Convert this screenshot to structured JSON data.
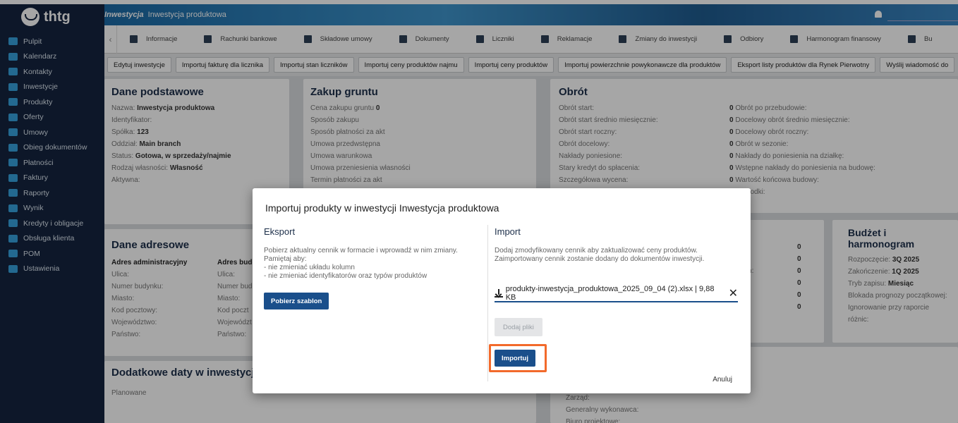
{
  "logo": {
    "text": "thtg"
  },
  "sidebar": {
    "items": [
      {
        "label": "Pulpit"
      },
      {
        "label": "Kalendarz"
      },
      {
        "label": "Kontakty"
      },
      {
        "label": "Inwestycje"
      },
      {
        "label": "Produkty"
      },
      {
        "label": "Oferty"
      },
      {
        "label": "Umowy"
      },
      {
        "label": "Obieg dokumentów"
      },
      {
        "label": "Płatności"
      },
      {
        "label": "Faktury"
      },
      {
        "label": "Raporty"
      },
      {
        "label": "Wynik"
      },
      {
        "label": "Kredyty i obligacje"
      },
      {
        "label": "Obsługa klienta"
      },
      {
        "label": "POM"
      },
      {
        "label": "Ustawienia"
      }
    ]
  },
  "header": {
    "crumb_main": "Inwestycja",
    "crumb_sub": "Inwestycja produktowa"
  },
  "tabs": [
    {
      "label": "Informacje"
    },
    {
      "label": "Rachunki bankowe"
    },
    {
      "label": "Składowe umowy"
    },
    {
      "label": "Dokumenty"
    },
    {
      "label": "Liczniki"
    },
    {
      "label": "Reklamacje"
    },
    {
      "label": "Zmiany do inwestycji"
    },
    {
      "label": "Odbiory"
    },
    {
      "label": "Harmonogram finansowy"
    },
    {
      "label": "Bu"
    }
  ],
  "actions": [
    {
      "label": "Edytuj inwestycje"
    },
    {
      "label": "Importuj fakturę dla licznika"
    },
    {
      "label": "Importuj stan liczników"
    },
    {
      "label": "Importuj ceny produktów najmu"
    },
    {
      "label": "Importuj ceny produktów"
    },
    {
      "label": "Importuj powierzchnie powykonawcze dla produktów"
    },
    {
      "label": "Eksport listy produktów dla Rynek Pierwotny"
    },
    {
      "label": "Wyślij wiadomość do"
    }
  ],
  "basic": {
    "title": "Dane podstawowe",
    "rows": [
      {
        "label": "Nazwa:",
        "value": "Inwestycja produktowa"
      },
      {
        "label": "Identyfikator:",
        "value": ""
      },
      {
        "label": "Spółka:",
        "value": "123"
      },
      {
        "label": "Oddział:",
        "value": "Main branch"
      },
      {
        "label": "Status:",
        "value": "Gotowa, w sprzedaży/najmie"
      },
      {
        "label": "Rodzaj własności:",
        "value": "Własność"
      },
      {
        "label": "Aktywna:",
        "value": ""
      }
    ]
  },
  "land": {
    "title": "Zakup gruntu",
    "rows": [
      {
        "label": "Cena zakupu gruntu",
        "value": "0"
      },
      {
        "label": "Sposób zakupu",
        "value": ""
      },
      {
        "label": "Sposób płatności za akt",
        "value": ""
      },
      {
        "label": "Umowa przedwstępna",
        "value": ""
      },
      {
        "label": "Umowa warunkowa",
        "value": ""
      },
      {
        "label": "Umowa przeniesienia własności",
        "value": ""
      },
      {
        "label": "Termin płatności za akt",
        "value": ""
      }
    ]
  },
  "turnover": {
    "title": "Obrót",
    "left": [
      {
        "label": "Obrót start:",
        "value": "0"
      },
      {
        "label": "Obrót start średnio miesięcznie:",
        "value": "0"
      },
      {
        "label": "Obrót start roczny:",
        "value": "0"
      },
      {
        "label": "Obrót docelowy:",
        "value": "0"
      },
      {
        "label": "Nakłady poniesione:",
        "value": "0"
      },
      {
        "label": "Stary kredyt do spłacenia:",
        "value": "0"
      },
      {
        "label": "Szczegółowa wycena:",
        "value": "0"
      }
    ],
    "right": [
      {
        "label": "Obrót po przebudowie:"
      },
      {
        "label": "Docelowy obrót średnio miesięcznie:"
      },
      {
        "label": "Docelowy obrót roczny:"
      },
      {
        "label": "Obrót w sezonie:"
      },
      {
        "label": "Nakłady do poniesienia na działkę:"
      },
      {
        "label": "Wstępne nakłady do poniesienia na budowę:"
      },
      {
        "label": "Wartość końcowa budowy:"
      },
      {
        "label": "jące środki:"
      }
    ]
  },
  "address": {
    "title": "Dane adresowe",
    "col1_head": "Adres administracyjny",
    "col2_head": "Adres budo",
    "rows": [
      {
        "label": "Ulica:"
      },
      {
        "label": "Numer budynku:"
      },
      {
        "label": "Miasto:"
      },
      {
        "label": "Kod pocztowy:"
      },
      {
        "label": "Województwo:"
      },
      {
        "label": "Państwo:"
      }
    ],
    "rows2": [
      {
        "label": "Ulica:"
      },
      {
        "label": "Numer bud"
      },
      {
        "label": "Miasto:"
      },
      {
        "label": "Kod poczt"
      },
      {
        "label": "Województ"
      },
      {
        "label": "Państwo:"
      }
    ]
  },
  "mid_partial": {
    "labels": [
      {
        "label": "munikacyjnych:"
      },
      {
        "label": "emców:"
      }
    ],
    "values": [
      "0",
      "0",
      "0",
      "0",
      "0",
      "0"
    ]
  },
  "budget": {
    "title": "Budżet i harmonogram",
    "rows": [
      {
        "label": "Rozpoczęcie:",
        "value": "3Q 2025"
      },
      {
        "label": "Zakończenie:",
        "value": "1Q 2025"
      },
      {
        "label": "Tryb zapisu:",
        "value": "Miesiąc"
      },
      {
        "label": "Blokada prognozy początkowej:",
        "value": ""
      },
      {
        "label": "Ignorowanie przy raporcie różnic:",
        "value": ""
      }
    ]
  },
  "dates": {
    "title": "Dodatkowe daty w inwestycji",
    "planned": "Planowane"
  },
  "bottom_rows": [
    {
      "label": "Zarząd:"
    },
    {
      "label": "Generalny wykonawca:"
    },
    {
      "label": "Biuro projektowe:"
    }
  ],
  "modal": {
    "title": "Importuj produkty w inwestycji Inwestycja produktowa",
    "export": {
      "title": "Eksport",
      "text": "Pobierz aktualny cennik w formacie i wprowadź w nim zmiany.\nPamiętaj aby:\n- nie zmieniać układu kolumn\n- nie zmieniać identyfikatorów oraz typów produktów",
      "button": "Pobierz szablon"
    },
    "import": {
      "title": "Import",
      "text": "Dodaj zmodyfikowany cennik aby zaktualizować ceny produktów.\nZaimportowany cennik zostanie dodany do dokumentów inwestycji.",
      "file": "produkty-inwestycja_produktowa_2025_09_04 (2).xlsx | 9,88 KB",
      "add_files": "Dodaj pliki",
      "import_button": "Importuj"
    },
    "cancel": "Anuluj"
  },
  "colors": {
    "sidebar": "#15243f",
    "primary": "#1a4f8b",
    "highlight": "#f26a2b"
  }
}
